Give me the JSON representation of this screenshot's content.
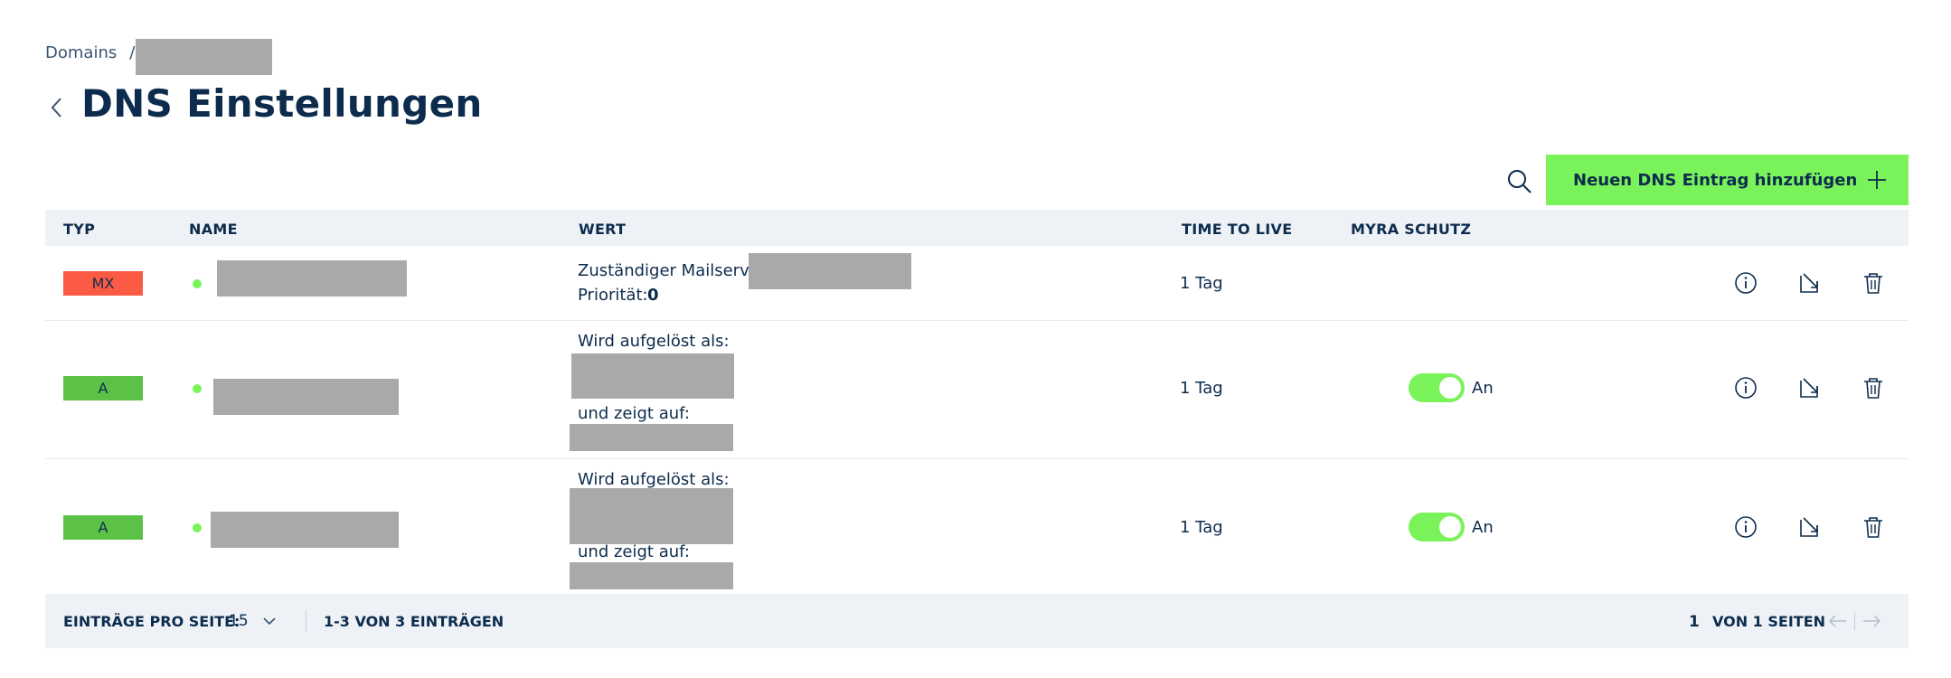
{
  "breadcrumb": {
    "root": "Domains",
    "separator": "/"
  },
  "page": {
    "title": "DNS Einstellungen"
  },
  "toolbar": {
    "add_button_label": "Neuen DNS Eintrag hinzufügen"
  },
  "table": {
    "columns": [
      "TYP",
      "NAME",
      "WERT",
      "TIME TO LIVE",
      "MYRA SCHUTZ"
    ],
    "rows": [
      {
        "type": "MX",
        "type_color": "#fb5a45",
        "status_color": "#7af35b",
        "value_line1_label": "Zuständiger Mailserver:",
        "value_line2_label": "Priorität:",
        "value_line2_value": "0",
        "ttl": "1 Tag"
      },
      {
        "type": "A",
        "type_color": "#5cc247",
        "status_color": "#7af35b",
        "value_line1_label": "Wird aufgelöst als:",
        "value_line2_label": "und zeigt auf:",
        "ttl": "1 Tag",
        "protection": {
          "enabled": true,
          "label": "An"
        }
      },
      {
        "type": "A",
        "type_color": "#5cc247",
        "status_color": "#7af35b",
        "value_line1_label": "Wird aufgelöst als:",
        "value_line2_label": "und zeigt auf:",
        "ttl": "1 Tag",
        "protection": {
          "enabled": true,
          "label": "An"
        }
      }
    ],
    "row_icons": [
      "info-icon",
      "edit-icon",
      "trash-icon"
    ]
  },
  "pagination": {
    "per_page_label": "EINTRÄGE PRO SEITE:",
    "per_page_value": "15",
    "range_label": "1-3 VON 3 EINTRÄGEN",
    "current_page": "1",
    "total_label": "VON 1 SEITEN"
  },
  "colors": {
    "accent": "#7af35b",
    "text": "#0d2c4d",
    "table_header_bg": "#eef2f7"
  }
}
